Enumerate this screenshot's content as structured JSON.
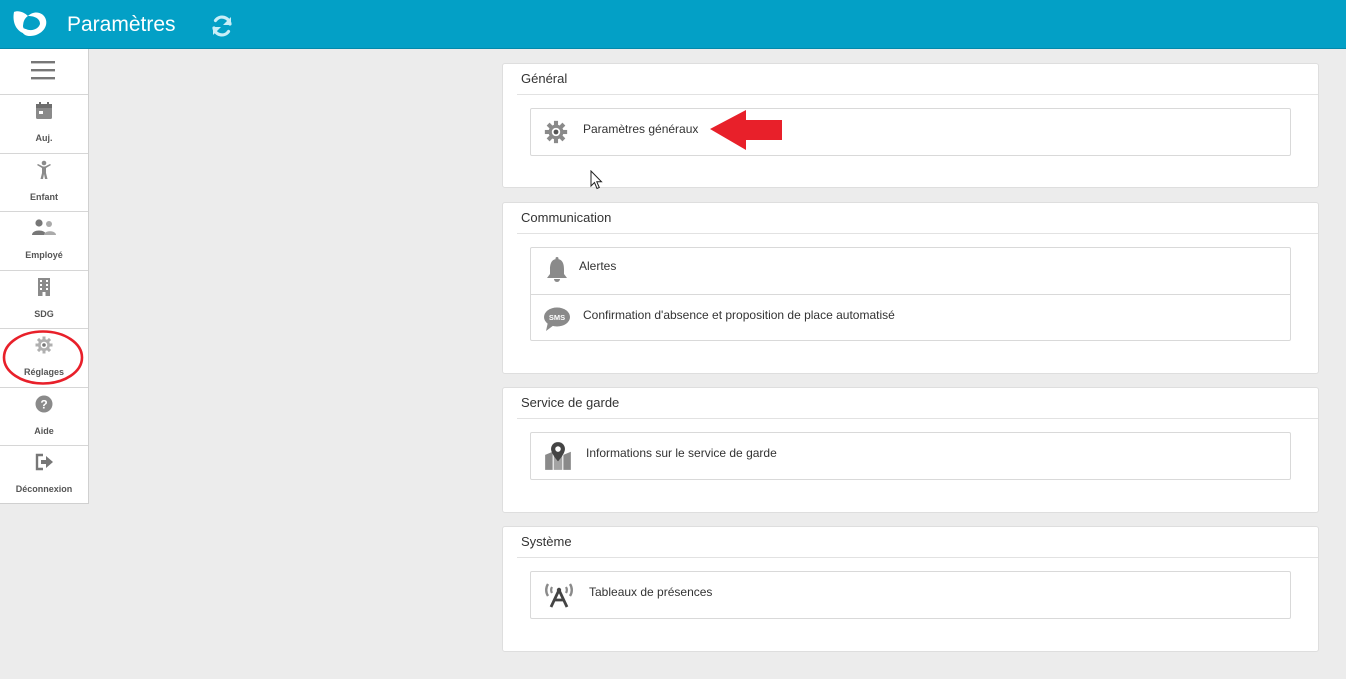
{
  "header": {
    "title": "Paramètres",
    "accent_color": "#03a0c6",
    "logo_icon": "butterfly-logo-icon",
    "refresh_icon": "refresh-icon"
  },
  "sidebar": {
    "menu_icon": "hamburger-menu-icon",
    "items": [
      {
        "label": "Auj.",
        "icon": "calendar-icon"
      },
      {
        "label": "Enfant",
        "icon": "child-icon"
      },
      {
        "label": "Employé",
        "icon": "users-icon"
      },
      {
        "label": "SDG",
        "icon": "building-icon"
      },
      {
        "label": "Réglages",
        "icon": "gear-icon"
      },
      {
        "label": "Aide",
        "icon": "question-circle-icon"
      },
      {
        "label": "Déconnexion",
        "icon": "sign-out-icon"
      }
    ]
  },
  "sections": [
    {
      "title": "Général",
      "items": [
        {
          "label": "Paramètres généraux",
          "icon": "gear-icon"
        }
      ]
    },
    {
      "title": "Communication",
      "items": [
        {
          "label": "Alertes",
          "icon": "bell-icon"
        },
        {
          "label": "Confirmation d'absence et proposition de place automatisé",
          "icon": "sms-bubble-icon"
        }
      ]
    },
    {
      "title": "Service de garde",
      "items": [
        {
          "label": "Informations sur le service de garde",
          "icon": "map-marker-icon"
        }
      ]
    },
    {
      "title": "Système",
      "items": [
        {
          "label": "Tableaux de présences",
          "icon": "antenna-icon"
        }
      ]
    }
  ],
  "annotations": {
    "arrow_color": "#e8202a",
    "circle_color": "#e8202a"
  }
}
